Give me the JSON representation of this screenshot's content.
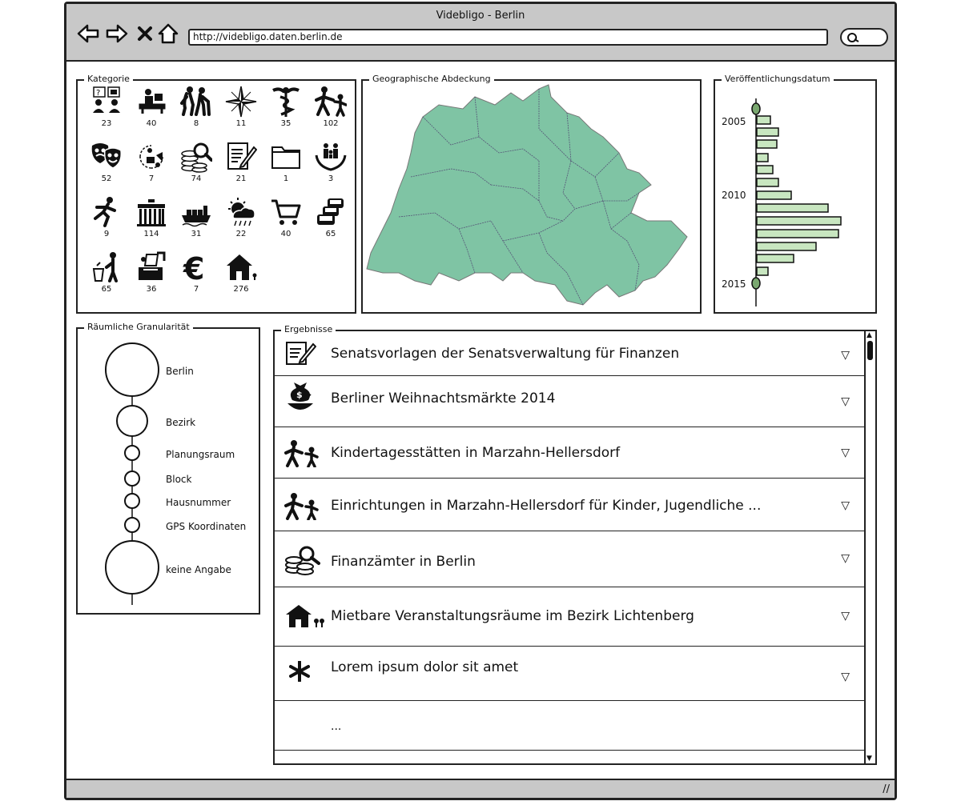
{
  "window": {
    "title": "Videbligo - Berlin"
  },
  "browser": {
    "url": "http://videbligo.daten.berlin.de"
  },
  "kategorie": {
    "legend": "Kategorie",
    "items": [
      {
        "icon": "question-people-icon",
        "count": "23"
      },
      {
        "icon": "desk-worker-icon",
        "count": "40"
      },
      {
        "icon": "elderly-couple-icon",
        "count": "8"
      },
      {
        "icon": "compass-rose-icon",
        "count": "11"
      },
      {
        "icon": "caduceus-icon",
        "count": "35"
      },
      {
        "icon": "parent-child-icon",
        "count": "102"
      },
      {
        "icon": "theater-masks-icon",
        "count": "52"
      },
      {
        "icon": "recycling-people-icon",
        "count": "7"
      },
      {
        "icon": "coins-magnifier-icon",
        "count": "74"
      },
      {
        "icon": "document-pen-icon",
        "count": "21"
      },
      {
        "icon": "folder-icon",
        "count": "1"
      },
      {
        "icon": "family-hands-icon",
        "count": "3"
      },
      {
        "icon": "runner-icon",
        "count": "9"
      },
      {
        "icon": "brandenburg-gate-icon",
        "count": "114"
      },
      {
        "icon": "cargo-ship-icon",
        "count": "31"
      },
      {
        "icon": "weather-icon",
        "count": "22"
      },
      {
        "icon": "shopping-cart-icon",
        "count": "40"
      },
      {
        "icon": "traffic-cars-icon",
        "count": "65"
      },
      {
        "icon": "trash-person-icon",
        "count": "65"
      },
      {
        "icon": "ballot-box-icon",
        "count": "36"
      },
      {
        "icon": "euro-icon",
        "count": "7"
      },
      {
        "icon": "house-tree-icon",
        "count": "276"
      }
    ]
  },
  "geo": {
    "legend": "Geographische Abdeckung",
    "fill_color": "#7fc4a4"
  },
  "date": {
    "legend": "Veröffentlichungsdatum",
    "labels": [
      "2005",
      "2010",
      "2015"
    ],
    "bar_color": "#c8e6c0"
  },
  "granularity": {
    "legend": "Räumliche Granularität",
    "levels": [
      {
        "label": "Berlin"
      },
      {
        "label": "Bezirk"
      },
      {
        "label": "Planungsraum"
      },
      {
        "label": "Block"
      },
      {
        "label": "Hausnummer"
      },
      {
        "label": "GPS Koordinaten"
      },
      {
        "label": "keine Angabe"
      }
    ]
  },
  "results": {
    "legend": "Ergebnisse",
    "items": [
      {
        "title": "Senatsvorlagen der Senatsverwaltung für Finanzen",
        "icon": "document-pen-icon"
      },
      {
        "title": "Berliner Weihnachtsmärkte 2014",
        "icon": "money-bag-bowl-icon"
      },
      {
        "title": "Kindertagesstätten in Marzahn-Hellersdorf",
        "icon": "parent-child-icon"
      },
      {
        "title": "Einrichtungen in Marzahn-Hellersdorf für Kinder, Jugendliche ...",
        "icon": "parent-child-icon"
      },
      {
        "title": "Finanzämter in Berlin",
        "icon": "coins-magnifier-icon"
      },
      {
        "title": "Mietbare Veranstaltungsräume im Bezirk Lichtenberg",
        "icon": "house-tree-icon"
      },
      {
        "title": "Lorem ipsum dolor sit amet",
        "icon": "asterisk-icon"
      },
      {
        "title": "..."
      }
    ],
    "toggle_glyph": "▽"
  }
}
